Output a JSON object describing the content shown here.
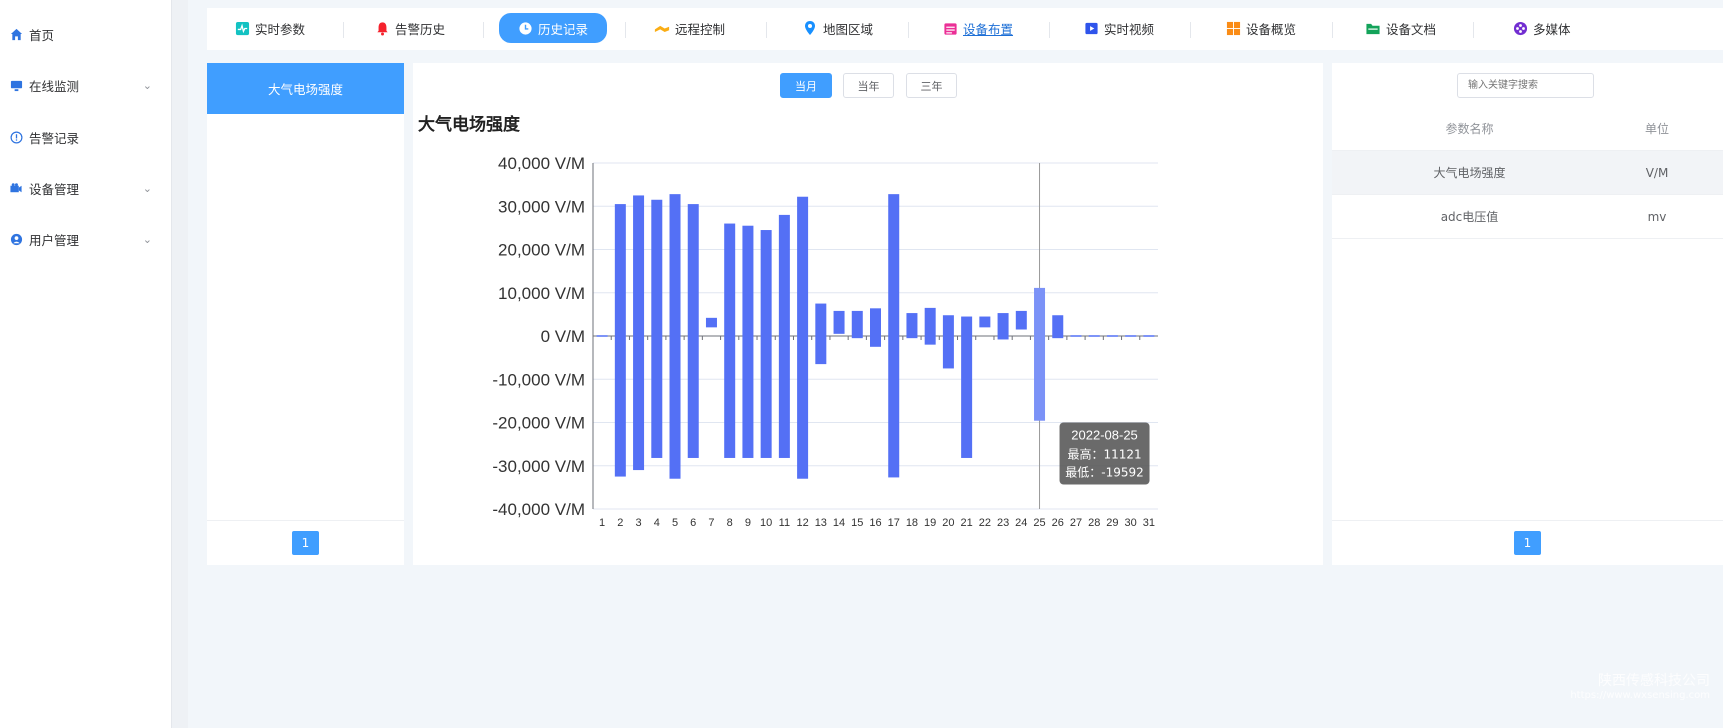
{
  "sidebar": {
    "items": [
      {
        "label": "首页",
        "icon": "home-icon",
        "expandable": false
      },
      {
        "label": "在线监测",
        "icon": "monitor-icon",
        "expandable": true
      },
      {
        "label": "告警记录",
        "icon": "alert-circle-icon",
        "expandable": false
      },
      {
        "label": "设备管理",
        "icon": "device-icon",
        "expandable": true
      },
      {
        "label": "用户管理",
        "icon": "user-icon",
        "expandable": true
      }
    ]
  },
  "tabs": [
    {
      "label": "实时参数",
      "icon": "realtime-chart-icon",
      "color": "#13c2c2"
    },
    {
      "label": "告警历史",
      "icon": "bell-icon",
      "color": "#f5222d"
    },
    {
      "label": "历史记录",
      "icon": "clock-icon",
      "color": "#ffffff",
      "active": true
    },
    {
      "label": "远程控制",
      "icon": "remote-control-icon",
      "color": "#faad14"
    },
    {
      "label": "地图区域",
      "icon": "map-pin-icon",
      "color": "#1890ff"
    },
    {
      "label": "设备布置",
      "icon": "calendar-icon",
      "color": "#eb2f96",
      "link": true
    },
    {
      "label": "实时视频",
      "icon": "video-icon",
      "color": "#2f54eb"
    },
    {
      "label": "设备概览",
      "icon": "grid-icon",
      "color": "#fa8c16"
    },
    {
      "label": "设备文档",
      "icon": "folder-icon",
      "color": "#52c41a"
    },
    {
      "label": "多媒体",
      "icon": "multimedia-icon",
      "color": "#722ed1"
    }
  ],
  "left_panel": {
    "items": [
      "大气电场强度"
    ],
    "page": "1"
  },
  "range_buttons": [
    {
      "label": "当月",
      "active": true
    },
    {
      "label": "当年",
      "active": false
    },
    {
      "label": "三年",
      "active": false
    }
  ],
  "chart_data": {
    "type": "bar",
    "title": "大气电场强度",
    "unit": "V/M",
    "ylim": [
      -40000,
      40000
    ],
    "y_ticks": [
      "40,000 V/M",
      "30,000 V/M",
      "20,000 V/M",
      "10,000 V/M",
      "0 V/M",
      "-10,000 V/M",
      "-20,000 V/M",
      "-30,000 V/M",
      "-40,000 V/M"
    ],
    "categories": [
      "1",
      "2",
      "3",
      "4",
      "5",
      "6",
      "7",
      "8",
      "9",
      "10",
      "11",
      "12",
      "13",
      "14",
      "15",
      "16",
      "17",
      "18",
      "19",
      "20",
      "21",
      "22",
      "23",
      "24",
      "25",
      "26",
      "27",
      "28",
      "29",
      "30",
      "31"
    ],
    "series": [
      {
        "name": "最高",
        "values": [
          0,
          30500,
          32500,
          31500,
          32800,
          30500,
          4200,
          26000,
          25500,
          24500,
          28000,
          32200,
          7500,
          5800,
          5800,
          6400,
          32800,
          5300,
          6500,
          4800,
          4500,
          4500,
          5300,
          5800,
          11121,
          4800,
          0,
          0,
          0,
          0,
          0
        ]
      },
      {
        "name": "最低",
        "values": [
          0,
          -32500,
          -31000,
          -28200,
          -33000,
          -28200,
          2000,
          -28200,
          -28200,
          -28200,
          -28200,
          -33000,
          -6500,
          500,
          -500,
          -2500,
          -32700,
          -500,
          -2000,
          -7500,
          -28200,
          2000,
          -800,
          1500,
          -19592,
          -500,
          0,
          0,
          0,
          0,
          0
        ]
      }
    ],
    "grid": true,
    "tooltip": {
      "category_index": 24,
      "date": "2022-08-25",
      "high_label": "最高：11121",
      "low_label": "最低：-19592"
    },
    "bar_color": "#5470f5",
    "highlight_color": "#7b92f7"
  },
  "right_panel": {
    "search_placeholder": "输入关键字搜索",
    "columns": [
      "参数名称",
      "单位"
    ],
    "rows": [
      {
        "name": "大气电场强度",
        "unit": "V/M",
        "selected": true
      },
      {
        "name": "adc电压值",
        "unit": "mv",
        "selected": false
      }
    ],
    "page": "1"
  },
  "watermark": {
    "name": "陕西传感科技公司",
    "url": "https://www.wxsensing.com"
  }
}
